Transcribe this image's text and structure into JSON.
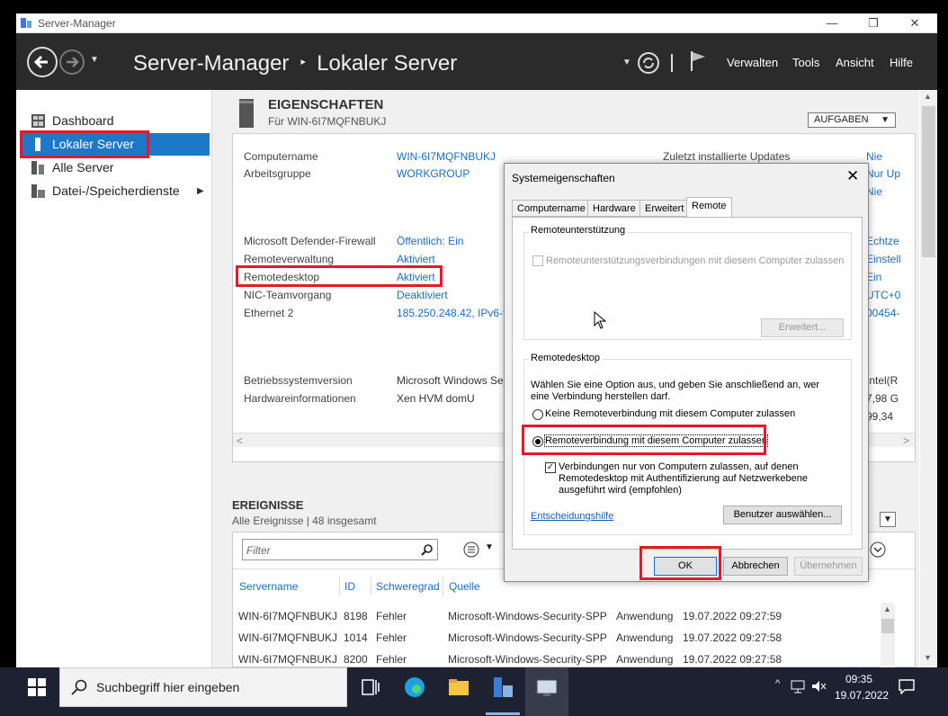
{
  "window": {
    "title": "Server-Manager",
    "controls": [
      "—",
      "❐",
      "✕"
    ]
  },
  "header": {
    "breadcrumb_root": "Server-Manager",
    "breadcrumb_sep": "‣",
    "breadcrumb_page": "Lokaler Server",
    "menus": [
      "Verwalten",
      "Tools",
      "Ansicht",
      "Hilfe"
    ]
  },
  "sidebar": {
    "items": [
      {
        "label": "Dashboard"
      },
      {
        "label": "Lokaler Server"
      },
      {
        "label": "Alle Server"
      },
      {
        "label": "Datei-/Speicherdienste"
      }
    ]
  },
  "properties": {
    "heading": "EIGENSCHAFTEN",
    "subheading": "Für WIN-6I7MQFNBUKJ",
    "tasks_button": "AUFGABEN",
    "rows": [
      {
        "label": "Computername",
        "value": "WIN-6I7MQFNBUKJ"
      },
      {
        "label": "Arbeitsgruppe",
        "value": "WORKGROUP"
      },
      {
        "label": "Microsoft Defender-Firewall",
        "value": "Öffentlich: Ein"
      },
      {
        "label": "Remoteverwaltung",
        "value": "Aktiviert"
      },
      {
        "label": "Remotedesktop",
        "value": "Aktiviert"
      },
      {
        "label": "NIC-Teamvorgang",
        "value": "Deaktiviert"
      },
      {
        "label": "Ethernet 2",
        "value": "185.250.248.42, IPv6-fä"
      },
      {
        "label": "Betriebssystemversion",
        "value": "Microsoft Windows Ser"
      },
      {
        "label": "Hardwareinformationen",
        "value": "Xen HVM domU"
      }
    ],
    "right_label": "Zuletzt installierte Updates",
    "right_values": [
      "Nie",
      "Nur Up",
      "Nie",
      "Echtze",
      "Einstell",
      "Ein",
      "UTC+0",
      "00454-",
      "Intel(R",
      "7,98 G",
      "99,34"
    ]
  },
  "events": {
    "heading": "EREIGNISSE",
    "subheading": "Alle Ereignisse | 48 insgesamt",
    "filter_placeholder": "Filter",
    "columns": [
      "Servername",
      "ID",
      "Schweregrad",
      "Quelle"
    ],
    "rows": [
      [
        "WIN-6I7MQFNBUKJ",
        "8198",
        "Fehler",
        "Microsoft-Windows-Security-SPP",
        "Anwendung",
        "19.07.2022 09:27:59"
      ],
      [
        "WIN-6I7MQFNBUKJ",
        "1014",
        "Fehler",
        "Microsoft-Windows-Security-SPP",
        "Anwendung",
        "19.07.2022 09:27:58"
      ],
      [
        "WIN-6I7MQFNBUKJ",
        "8200",
        "Fehler",
        "Microsoft-Windows-Security-SPP",
        "Anwendung",
        "19.07.2022 09:27:58"
      ]
    ]
  },
  "dialog": {
    "title": "Systemeigenschaften",
    "tabs": [
      "Computername",
      "Hardware",
      "Erweitert",
      "Remote"
    ],
    "assist_group": "Remoteunterstützung",
    "assist_checkbox": "Remoteunterstützungsverbindungen mit diesem Computer zulassen",
    "advanced_button": "Erweitert...",
    "rd_group": "Remotedesktop",
    "rd_intro": "Wählen Sie eine Option aus, und geben Sie anschließend an, wer eine Verbindung herstellen darf.",
    "rd_option_none": "Keine Remoteverbindung mit diesem Computer zulassen",
    "rd_option_allow": "Remoteverbindung mit diesem Computer zulassen",
    "nla_checkbox": "Verbindungen nur von Computern zulassen, auf denen Remotedesktop mit Authentifizierung auf Netzwerkebene ausgeführt wird (empfohlen)",
    "help_link": "Entscheidungshilfe",
    "select_users_button": "Benutzer auswählen...",
    "ok": "OK",
    "cancel": "Abbrechen",
    "apply": "Übernehmen"
  },
  "taskbar": {
    "search_placeholder": "Suchbegriff hier eingeben",
    "time": "09:35",
    "date": "19.07.2022"
  },
  "colors": {
    "selection": "#1e78c8",
    "highlight": "#e21a2c",
    "link": "#1a6ec0"
  }
}
